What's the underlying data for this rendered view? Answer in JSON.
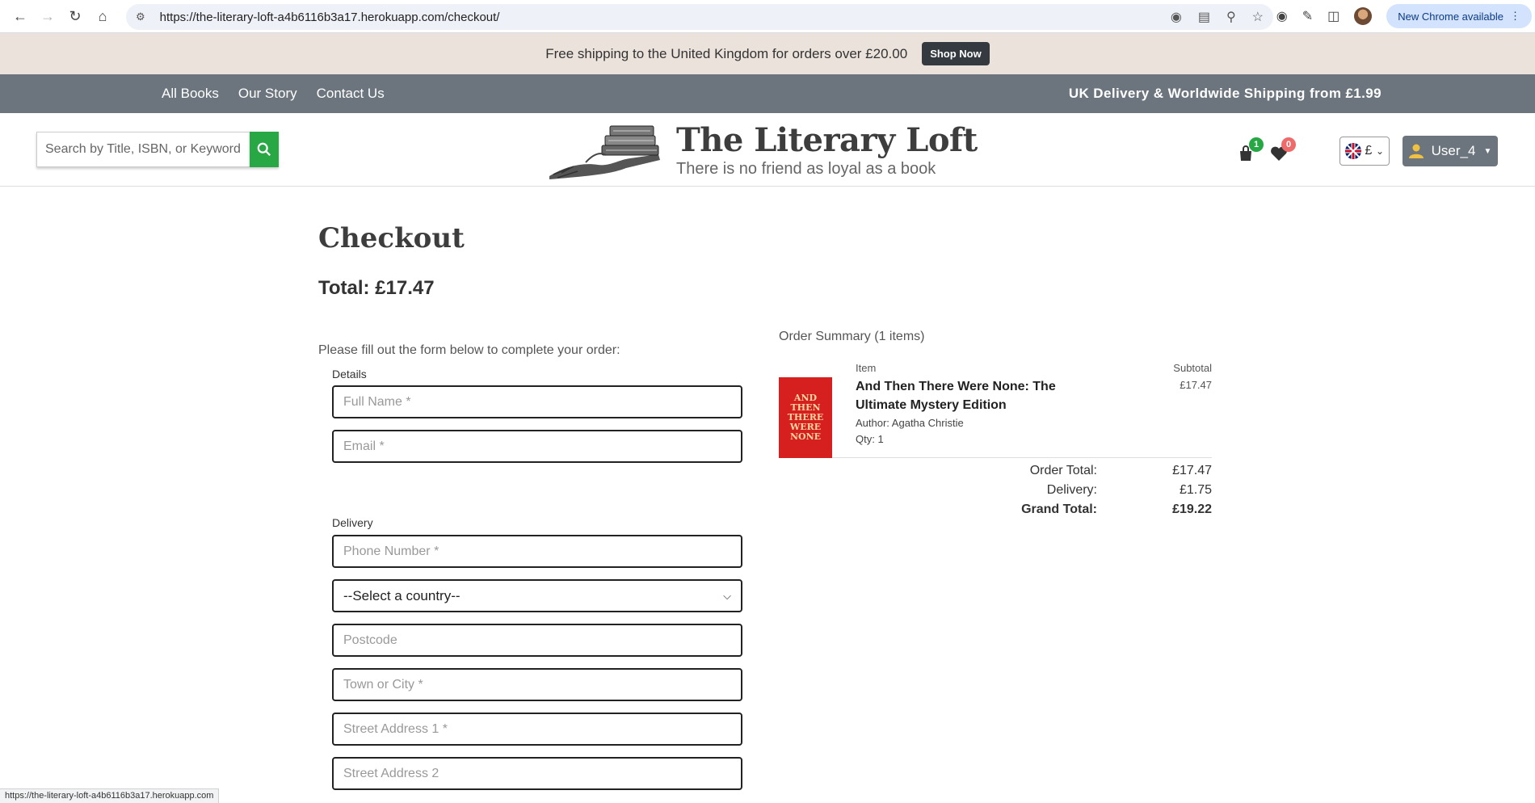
{
  "browser": {
    "url": "https://the-literary-loft-a4b6116b3a17.herokuapp.com/checkout/",
    "update_label": "New Chrome available",
    "status_url": "https://the-literary-loft-a4b6116b3a17.herokuapp.com"
  },
  "promo": {
    "text": "Free shipping to the United Kingdom for orders over £20.00",
    "button": "Shop Now"
  },
  "nav": {
    "items": [
      "All Books",
      "Our Story",
      "Contact Us"
    ],
    "shipping": "UK Delivery & Worldwide Shipping from £1.99"
  },
  "header": {
    "search_placeholder": "Search by Title, ISBN, or Keyword",
    "brand_title": "The Literary Loft",
    "brand_tagline": "There is no friend as loyal as a book",
    "cart_count": "1",
    "wishlist_count": "0",
    "currency": "£",
    "user": "User_4"
  },
  "checkout": {
    "title": "Checkout",
    "total": "Total: £17.47",
    "intro": "Please fill out the form below to complete your order:",
    "details_label": "Details",
    "delivery_label": "Delivery",
    "fields": {
      "full_name": "Full Name *",
      "email": "Email *",
      "phone": "Phone Number *",
      "country": "--Select a country--",
      "postcode": "Postcode",
      "town": "Town or City *",
      "street1": "Street Address 1 *",
      "street2": "Street Address 2"
    }
  },
  "summary": {
    "heading": "Order Summary (1 items)",
    "col_item": "Item",
    "col_subtotal": "Subtotal",
    "item": {
      "title": "And Then There Were None: The Ultimate Mystery Edition",
      "author": "Author: Agatha Christie",
      "qty": "Qty: 1",
      "subtotal": "£17.47",
      "cover_text": [
        "AND",
        "THEN",
        "THERE",
        "WERE",
        "NONE"
      ]
    },
    "order_total_label": "Order Total:",
    "order_total": "£17.47",
    "delivery_label": "Delivery:",
    "delivery": "£1.75",
    "grand_total_label": "Grand Total:",
    "grand_total": "£19.22"
  }
}
